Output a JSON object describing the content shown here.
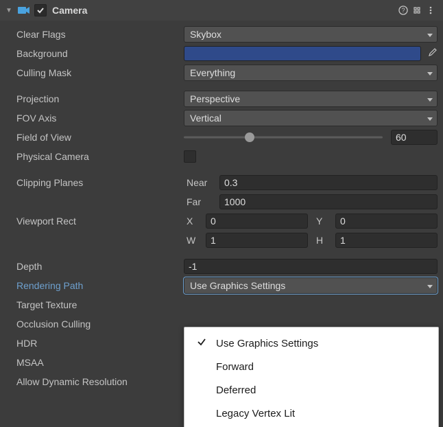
{
  "header": {
    "title": "Camera"
  },
  "labels": {
    "clear_flags": "Clear Flags",
    "background": "Background",
    "culling_mask": "Culling Mask",
    "projection": "Projection",
    "fov_axis": "FOV Axis",
    "field_of_view": "Field of View",
    "physical_camera": "Physical Camera",
    "clipping_planes": "Clipping Planes",
    "near": "Near",
    "far": "Far",
    "viewport_rect": "Viewport Rect",
    "x": "X",
    "y": "Y",
    "w": "W",
    "h": "H",
    "depth": "Depth",
    "rendering_path": "Rendering Path",
    "target_texture": "Target Texture",
    "occlusion_culling": "Occlusion Culling",
    "hdr": "HDR",
    "msaa": "MSAA",
    "allow_dynamic_resolution": "Allow Dynamic Resolution"
  },
  "values": {
    "clear_flags": "Skybox",
    "background_color": "#2f4a8a",
    "culling_mask": "Everything",
    "projection": "Perspective",
    "fov_axis": "Vertical",
    "field_of_view": "60",
    "near": "0.3",
    "far": "1000",
    "vx": "0",
    "vy": "0",
    "vw": "1",
    "vh": "1",
    "depth": "-1",
    "rendering_path": "Use Graphics Settings"
  },
  "slider": {
    "field_of_view_percent": 33
  },
  "dropdown": {
    "items": [
      {
        "label": "Use Graphics Settings",
        "checked": true
      },
      {
        "label": "Forward",
        "checked": false
      },
      {
        "label": "Deferred",
        "checked": false
      },
      {
        "label": "Legacy Vertex Lit",
        "checked": false
      }
    ]
  }
}
